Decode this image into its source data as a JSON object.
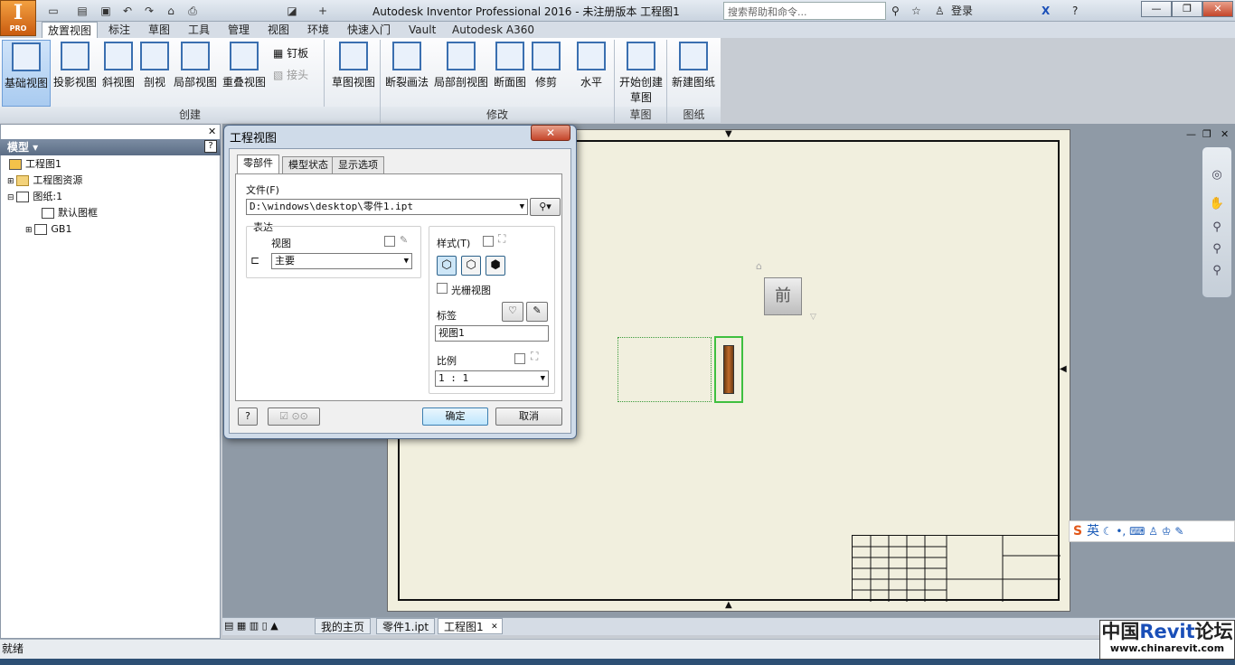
{
  "app": {
    "logo_letter": "I",
    "logo_edition": "PRO"
  },
  "title": "Autodesk Inventor Professional 2016 - 未注册版本   工程图1",
  "search": {
    "placeholder": "搜索帮助和命令..."
  },
  "signin": "登录",
  "window_controls": {
    "minimize": "—",
    "restore": "❐",
    "close": "✕"
  },
  "menu_tabs": [
    "放置视图",
    "标注",
    "草图",
    "工具",
    "管理",
    "视图",
    "环境",
    "快速入门",
    "Vault",
    "Autodesk A360"
  ],
  "ribbon": {
    "create": {
      "label": "创建",
      "buttons": [
        "基础视图",
        "投影视图",
        "斜视图",
        "剖视",
        "局部视图",
        "重叠视图"
      ],
      "small": [
        "钉板",
        "接头"
      ]
    },
    "sketch_view": "草图视图",
    "modify": {
      "label": "修改",
      "buttons": [
        "断裂画法",
        "局部剖视图",
        "断面图",
        "修剪"
      ]
    },
    "horizontal": "水平",
    "sketch": {
      "label": "草图",
      "button": "开始创建草图"
    },
    "sheet": {
      "label": "图纸",
      "button": "新建图纸"
    }
  },
  "browser": {
    "header": "模型 ▾",
    "items": [
      "工程图1",
      "工程图资源",
      "图纸:1",
      "默认图框",
      "GB1"
    ]
  },
  "dialog": {
    "title": "工程视图",
    "tabs": [
      "零部件",
      "模型状态",
      "显示选项"
    ],
    "file_label": "文件(F)",
    "file_value": "D:\\windows\\desktop\\零件1.ipt",
    "representation_label": "表达",
    "view_label": "视图",
    "view_value": "主要",
    "style_label": "样式(T)",
    "raster_label": "光栅视图",
    "label_label": "标签",
    "label_value": "视图1",
    "scale_label": "比例",
    "scale_value": "1 : 1",
    "ok": "确定",
    "cancel": "取消",
    "help": "?"
  },
  "viewcube": {
    "face": "前"
  },
  "doc_tabs": [
    "我的主页",
    "零件1.ipt",
    "工程图1"
  ],
  "status": "就绪",
  "ime": "英",
  "watermark": {
    "line1a": "中国",
    "line1b": "Revit",
    "line1c": "论坛",
    "line2": "www.chinarevit.com"
  }
}
